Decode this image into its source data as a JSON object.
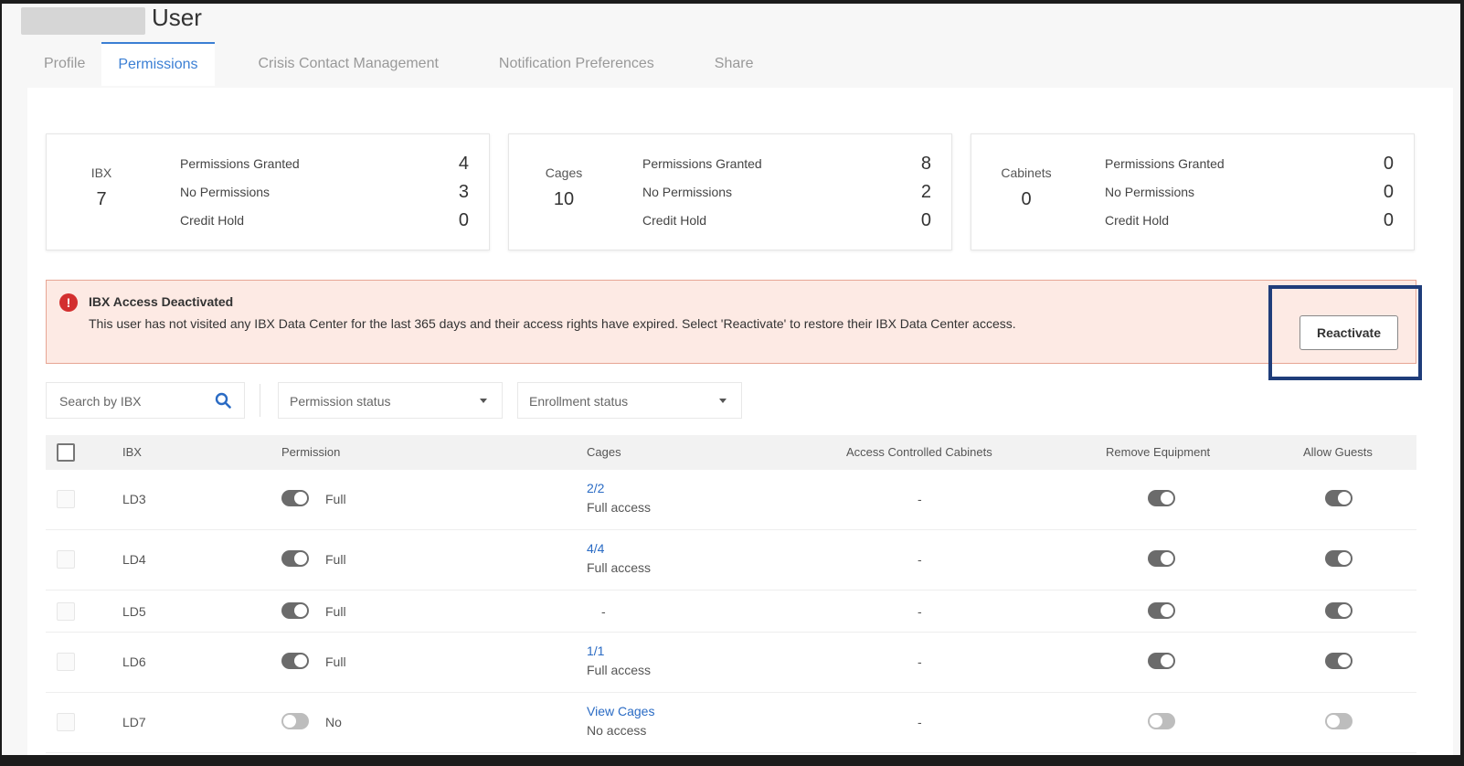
{
  "header": {
    "title": "User"
  },
  "tabs": [
    {
      "label": "Profile",
      "active": false
    },
    {
      "label": "Permissions",
      "active": true
    },
    {
      "label": "Crisis Contact Management",
      "active": false
    },
    {
      "label": "Notification Preferences",
      "active": false
    },
    {
      "label": "Share",
      "active": false
    }
  ],
  "summary": [
    {
      "label": "IBX",
      "total": "7",
      "granted_label": "Permissions Granted",
      "granted": "4",
      "none_label": "No Permissions",
      "none": "3",
      "hold_label": "Credit Hold",
      "hold": "0"
    },
    {
      "label": "Cages",
      "total": "10",
      "granted_label": "Permissions Granted",
      "granted": "8",
      "none_label": "No Permissions",
      "none": "2",
      "hold_label": "Credit Hold",
      "hold": "0"
    },
    {
      "label": "Cabinets",
      "total": "0",
      "granted_label": "Permissions Granted",
      "granted": "0",
      "none_label": "No Permissions",
      "none": "0",
      "hold_label": "Credit Hold",
      "hold": "0"
    }
  ],
  "alert": {
    "icon": "!",
    "title": "IBX Access Deactivated",
    "text": "This user has not visited any IBX Data Center for the last 365 days and their access rights have expired. Select 'Reactivate' to restore their IBX Data Center access.",
    "button": "Reactivate"
  },
  "filters": {
    "search_placeholder": "Search by IBX",
    "permission_status": "Permission status",
    "enrollment_status": "Enrollment status"
  },
  "table": {
    "headers": {
      "ibx": "IBX",
      "permission": "Permission",
      "cages": "Cages",
      "cabinets": "Access Controlled Cabinets",
      "remove": "Remove Equipment",
      "guests": "Allow Guests"
    },
    "rows": [
      {
        "ibx": "LD3",
        "permission": "Full",
        "perm_on": true,
        "cages_link": "2/2",
        "cages_sub": "Full access",
        "cabinets": "-",
        "remove_on": true,
        "guests_on": true
      },
      {
        "ibx": "LD4",
        "permission": "Full",
        "perm_on": true,
        "cages_link": "4/4",
        "cages_sub": "Full access",
        "cabinets": "-",
        "remove_on": true,
        "guests_on": true
      },
      {
        "ibx": "LD5",
        "permission": "Full",
        "perm_on": true,
        "cages_link": "",
        "cages_sub": "-",
        "cabinets": "-",
        "remove_on": true,
        "guests_on": true
      },
      {
        "ibx": "LD6",
        "permission": "Full",
        "perm_on": true,
        "cages_link": "1/1",
        "cages_sub": "Full access",
        "cabinets": "-",
        "remove_on": true,
        "guests_on": true
      },
      {
        "ibx": "LD7",
        "permission": "No",
        "perm_on": false,
        "cages_link": "View Cages",
        "cages_sub": "No access",
        "cabinets": "-",
        "remove_on": false,
        "guests_on": false
      }
    ]
  }
}
